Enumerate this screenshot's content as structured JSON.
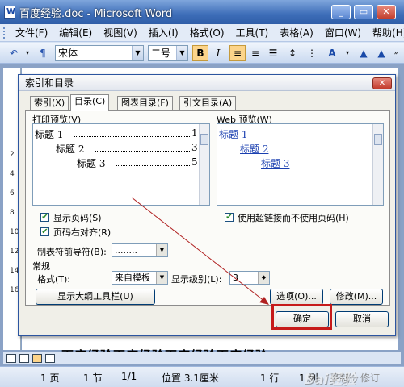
{
  "window": {
    "title": "百度经验.doc - Microsoft Word",
    "buttons": [
      "_",
      "▭",
      "✕"
    ]
  },
  "menubar": {
    "items": [
      "文件(F)",
      "编辑(E)",
      "视图(V)",
      "插入(I)",
      "格式(O)",
      "工具(T)",
      "表格(A)",
      "窗口(W)",
      "帮助(H)"
    ],
    "close": "✕"
  },
  "toolbar": {
    "font_name": "宋体",
    "font_size": "二号",
    "bold": "B",
    "italic": "I"
  },
  "ruler": {
    "ticks": [
      "2",
      "4",
      "6",
      "8",
      "10",
      "12",
      "14",
      "16"
    ]
  },
  "document": {
    "text": "百度经验百度经验百度经验百度经验"
  },
  "dialog": {
    "title": "索引和目录",
    "close": "✕",
    "tabs": [
      "索引(X)",
      "目录(C)",
      "图表目录(F)",
      "引文目录(A)"
    ],
    "active_tab": "目录(C)",
    "print_preview": {
      "label": "打印预览(V)",
      "lines": [
        {
          "text": "标题 1",
          "page": "1"
        },
        {
          "text": "标题 2",
          "page": "3"
        },
        {
          "text": "标题 3",
          "page": "5"
        }
      ]
    },
    "web_preview": {
      "label": "Web 预览(W)",
      "lines": [
        "标题 1",
        "标题 2",
        "标题 3"
      ]
    },
    "show_page_numbers": {
      "label": "显示页码(S)",
      "checked": true
    },
    "align_right": {
      "label": "页码右对齐(R)",
      "checked": true
    },
    "use_hyperlinks": {
      "label": "使用超链接而不使用页码(H)",
      "checked": true
    },
    "tab_leader": {
      "label": "制表符前导符(B):",
      "value": "........"
    },
    "general": {
      "label": "常规",
      "format_label": "格式(T):",
      "format_value": "来自模板",
      "levels_label": "显示级别(L):",
      "levels_value": "3"
    },
    "buttons": {
      "outline_toolbar": "显示大纲工具栏(U)",
      "options": "选项(O)...",
      "modify": "修改(M)...",
      "ok": "确定",
      "cancel": "取消"
    }
  },
  "statusbar": {
    "page": "1 页",
    "section": "1 节",
    "page_of": "1/1",
    "position": "位置 3.1厘米",
    "line": "1 行",
    "col": "1 列",
    "rec": "录制",
    "trk": "修订",
    "watermark": "Bai经验"
  },
  "colors": {
    "highlight": "#c61a1a",
    "titlebar": "#3d6db8",
    "link": "#1a3fb0"
  }
}
